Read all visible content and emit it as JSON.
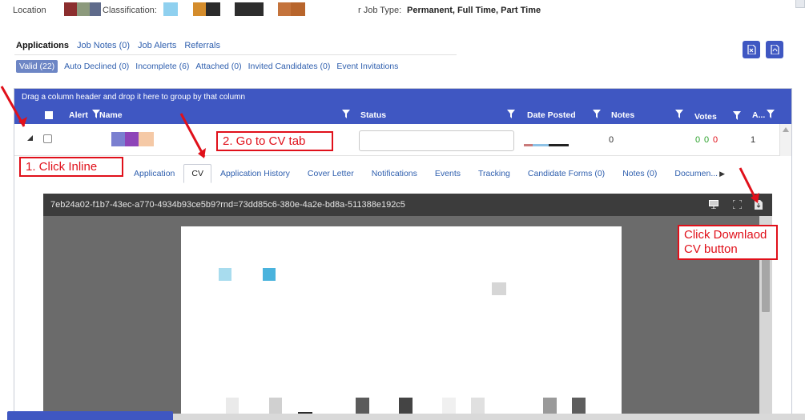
{
  "header": {
    "location_label": "Location",
    "classification_label": "Classification:",
    "job_type_label": "r Job Type:",
    "job_type_value": "Permanent, Full Time, Part Time"
  },
  "main_tabs": [
    "Applications",
    "Job Notes (0)",
    "Job Alerts",
    "Referrals"
  ],
  "sub_tabs": [
    "Valid (22)",
    "Auto Declined (0)",
    "Incomplete (6)",
    "Attached (0)",
    "Invited Candidates (0)",
    "Event Invitations"
  ],
  "grid": {
    "group_hint": "Drag a column header and drop it here to group by that column",
    "columns": {
      "alert": "Alert",
      "name": "Name",
      "status": "Status",
      "date_posted": "Date Posted",
      "notes": "Notes",
      "votes": "Votes",
      "a": "A..."
    },
    "row": {
      "notes": "0",
      "vote_a": "0",
      "vote_b": "0",
      "vote_c": "0",
      "a_value": "1"
    }
  },
  "detail_tabs": [
    "Application",
    "CV",
    "Application History",
    "Cover Letter",
    "Notifications",
    "Events",
    "Tracking",
    "Candidate Forms (0)",
    "Notes (0)",
    "Documen..."
  ],
  "viewer": {
    "filename": "7eb24a02-f1b7-43ec-a770-4934b93ce5b9?rnd=73dd85c6-380e-4a2e-bd8a-511388e192c5"
  },
  "annotations": {
    "step1": "1. Click Inline",
    "step2": "2. Go to CV tab",
    "step3": "Click Downlaod CV button"
  },
  "colors": {
    "header_blue": "#3f57c2",
    "annotation_red": "#e0101a",
    "link_blue": "#2f5fae",
    "vote_green": "#2aa12a",
    "vote_red": "#e0101a"
  }
}
